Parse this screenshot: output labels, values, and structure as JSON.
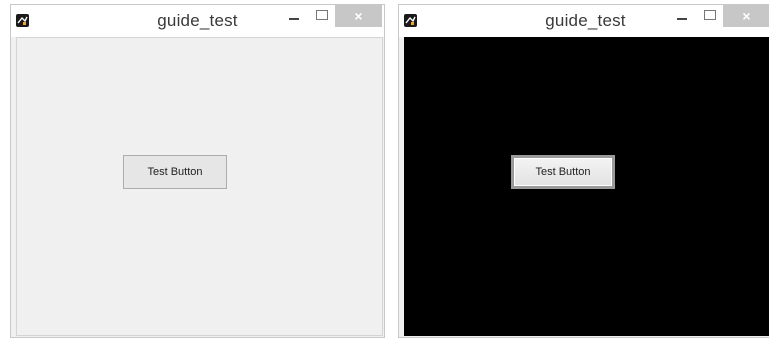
{
  "windows": [
    {
      "title": "guide_test",
      "button_label": "Test Button",
      "close_glyph": "×",
      "icons": [
        "app-icon",
        "minimize-icon",
        "maximize-icon",
        "close-icon"
      ],
      "background": "#f0f0f0"
    },
    {
      "title": "guide_test",
      "button_label": "Test Button",
      "close_glyph": "×",
      "icons": [
        "app-icon",
        "minimize-icon",
        "maximize-icon",
        "close-icon"
      ],
      "background": "#000000"
    }
  ]
}
